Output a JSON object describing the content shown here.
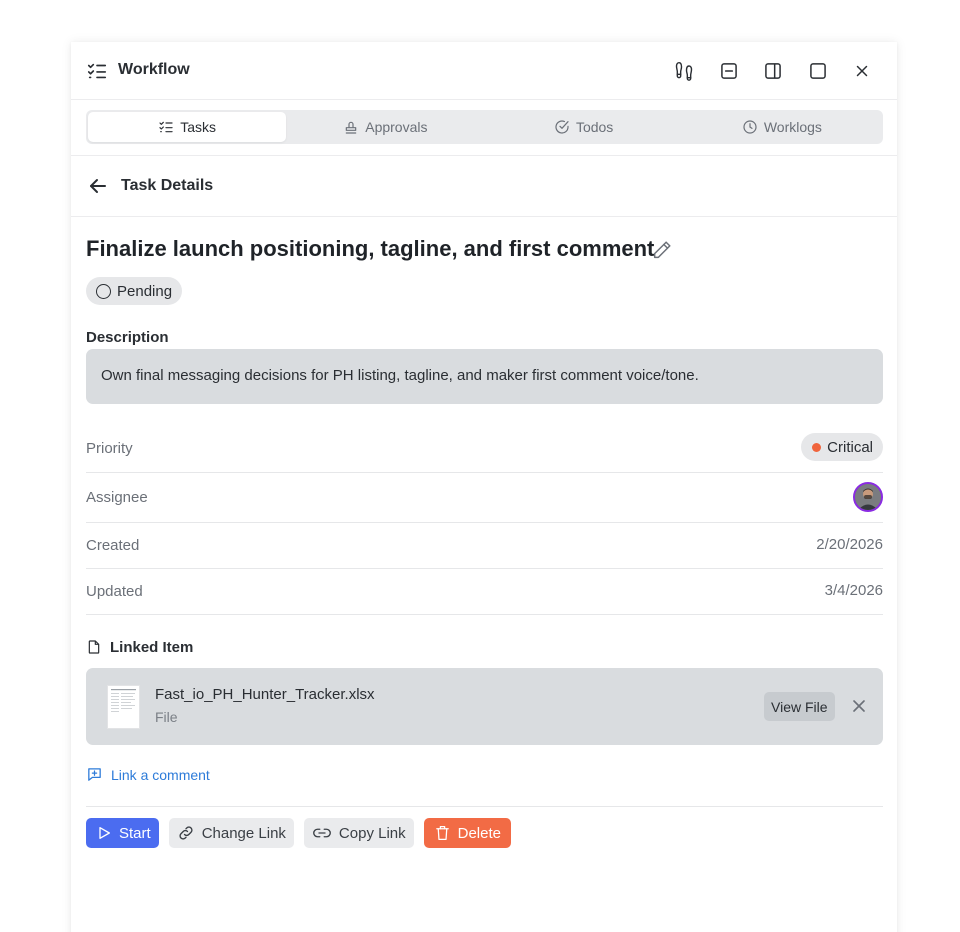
{
  "header": {
    "title": "Workflow",
    "icons": [
      "tasklist-icon",
      "footprints-icon",
      "minimize-icon",
      "split-panel-icon",
      "maximize-icon",
      "close-icon"
    ]
  },
  "tabs": [
    {
      "label": "Tasks",
      "icon": "tasklist-icon",
      "active": true
    },
    {
      "label": "Approvals",
      "icon": "stamp-icon",
      "active": false
    },
    {
      "label": "Todos",
      "icon": "check-circle-icon",
      "active": false
    },
    {
      "label": "Worklogs",
      "icon": "clock-icon",
      "active": false
    }
  ],
  "subheader": {
    "title": "Task Details"
  },
  "task": {
    "title": "Finalize launch positioning, tagline, and first comment",
    "status": "Pending",
    "description_label": "Description",
    "description": "Own final messaging decisions for PH listing, tagline, and maker first comment voice/tone."
  },
  "properties": {
    "priority_label": "Priority",
    "priority_value": "Critical",
    "priority_color": "#f0643c",
    "assignee_label": "Assignee",
    "created_label": "Created",
    "created_value": "2/20/2026",
    "updated_label": "Updated",
    "updated_value": "3/4/2026"
  },
  "linked": {
    "label": "Linked Item",
    "file_name": "Fast_io_PH_Hunter_Tracker.xlsx",
    "file_type": "File",
    "view_label": "View File",
    "link_comment_label": "Link a comment"
  },
  "actions": {
    "start": "Start",
    "change_link": "Change Link",
    "copy_link": "Copy Link",
    "delete": "Delete"
  },
  "colors": {
    "accent": "#4b6cf0",
    "danger": "#f26b45",
    "link": "#2d7bd9"
  }
}
